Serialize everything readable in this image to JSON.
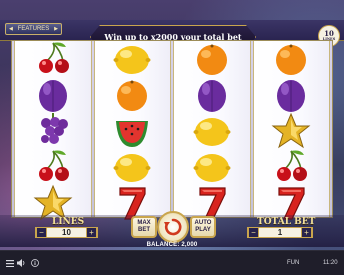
{
  "header": {
    "features_label": "FEATURES",
    "banner": "Win up to x2000 your total bet",
    "lines_badge_number": "10",
    "lines_badge_text": "LINES"
  },
  "reels": [
    [
      "cherries-icon",
      "plum-icon",
      "grapes-icon",
      "cherries-icon",
      "star-icon"
    ],
    [
      "lemon-icon",
      "orange-icon",
      "watermelon-icon",
      "lemon-icon",
      "seven-icon"
    ],
    [
      "orange-icon",
      "plum-icon",
      "lemon-icon",
      "lemon-icon",
      "seven-icon"
    ],
    [
      "orange-icon",
      "plum-icon",
      "star-icon",
      "cherries-icon",
      "seven-icon"
    ]
  ],
  "controls": {
    "lines_title": "LINES",
    "lines_value": "10",
    "max_bet_line1": "MAX",
    "max_bet_line2": "BET",
    "auto_play_line1": "AUTO",
    "auto_play_line2": "PLAY",
    "total_bet_title": "TOTAL BET",
    "total_bet_value": "1",
    "minus": "−",
    "plus": "+"
  },
  "balance_text": "BALANCE: 2,000",
  "footer": {
    "mode": "FUN",
    "time": "11:20"
  },
  "colors": {
    "gold": "#c9a54d",
    "navy": "#27224c",
    "reel_bg": "#ffffff"
  }
}
